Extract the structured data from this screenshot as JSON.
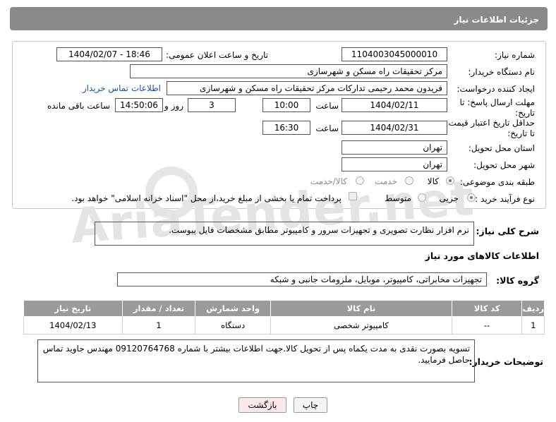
{
  "header": {
    "title": "جزئیات اطلاعات نیاز"
  },
  "form": {
    "need_number_label": "شماره نیاز:",
    "need_number": "1104003045000010",
    "announce_label": "تاریخ و ساعت اعلان عمومی:",
    "announce_value": "1404/02/07 - 18:46",
    "buyer_org_label": "نام دستگاه خریدار:",
    "buyer_org": "مرکز تحقیقات راه  مسکن و شهرسازی",
    "creator_label": "ایجاد کننده درخواست:",
    "creator": "فریدون محمد رحیمی تدارکات مرکز تحقیقات راه  مسکن و شهرسازی",
    "contact_link": "اطلاعات تماس خریدار",
    "deadline_label_1": "مهلت ارسال پاسخ: تا",
    "deadline_label_2": "تاریخ:",
    "deadline_date": "1404/02/11",
    "time_label": "ساعت",
    "deadline_time": "10:00",
    "days_value": "3",
    "days_label": "روز و",
    "remaining_time": "14:50:06",
    "remaining_label": "ساعت باقی مانده",
    "validity_label_1": "حداقل تاریخ اعتبار قیمت:",
    "validity_label_2": "تا تاریخ:",
    "validity_date": "1404/02/31",
    "validity_time": "16:30",
    "province_label": "استان محل تحویل:",
    "province": "تهران",
    "city_label": "شهر محل تحویل:",
    "city": "تهران",
    "category_label": "طبقه بندی موضوعی:",
    "category_options": [
      "کالا",
      "خدمت",
      "کالا/خدمت"
    ],
    "process_label": "نوع فرآیند خرید :",
    "process_options": [
      "جزیی",
      "متوسط"
    ],
    "payment_note": "پرداخت تمام یا بخشی از مبلغ خرید،از محل \"اسناد خزانه اسلامی\" خواهد بود."
  },
  "description": {
    "label": "شرح کلی نیاز:",
    "value": "نرم افزار نظارت تصویری و تجهیزات سرور و کامپیوتر مطابق مشخصات فایل پیوست."
  },
  "goods": {
    "section_title": "اطلاعات کالاهای مورد نیاز",
    "group_label": "گروه کالا:",
    "group_value": "تجهیزات مخابراتی، کامپیوتر، موبایل، ملزومات جانبی و شبکه",
    "columns": [
      "ردیف",
      "کد کالا",
      "نام کالا",
      "واحد شمارش",
      "تعداد / مقدار",
      "تاریخ نیاز"
    ],
    "rows": [
      [
        "1",
        "--",
        "کامپیوتر شخصی",
        "دستگاه",
        "1",
        "1404/02/13"
      ]
    ]
  },
  "buyer_notes": {
    "label": "توضیحات خریدار:",
    "value": "تسویه بصورت نقدی به مدت یکماه پس از تحویل کالا.جهت اطلاعات بیشتر با شماره 09120764768 مهندس جاوید تماس حاصل فرمایید."
  },
  "buttons": {
    "print": "چاپ",
    "back": "بازگشت"
  },
  "watermark": {
    "text": "AriaTender.net"
  },
  "colors": {
    "header_bg": "#8a8a8a",
    "table_header_bg": "#9a9a9a",
    "link": "#1a4fa0",
    "back_button_bg": "#fde8e8"
  }
}
